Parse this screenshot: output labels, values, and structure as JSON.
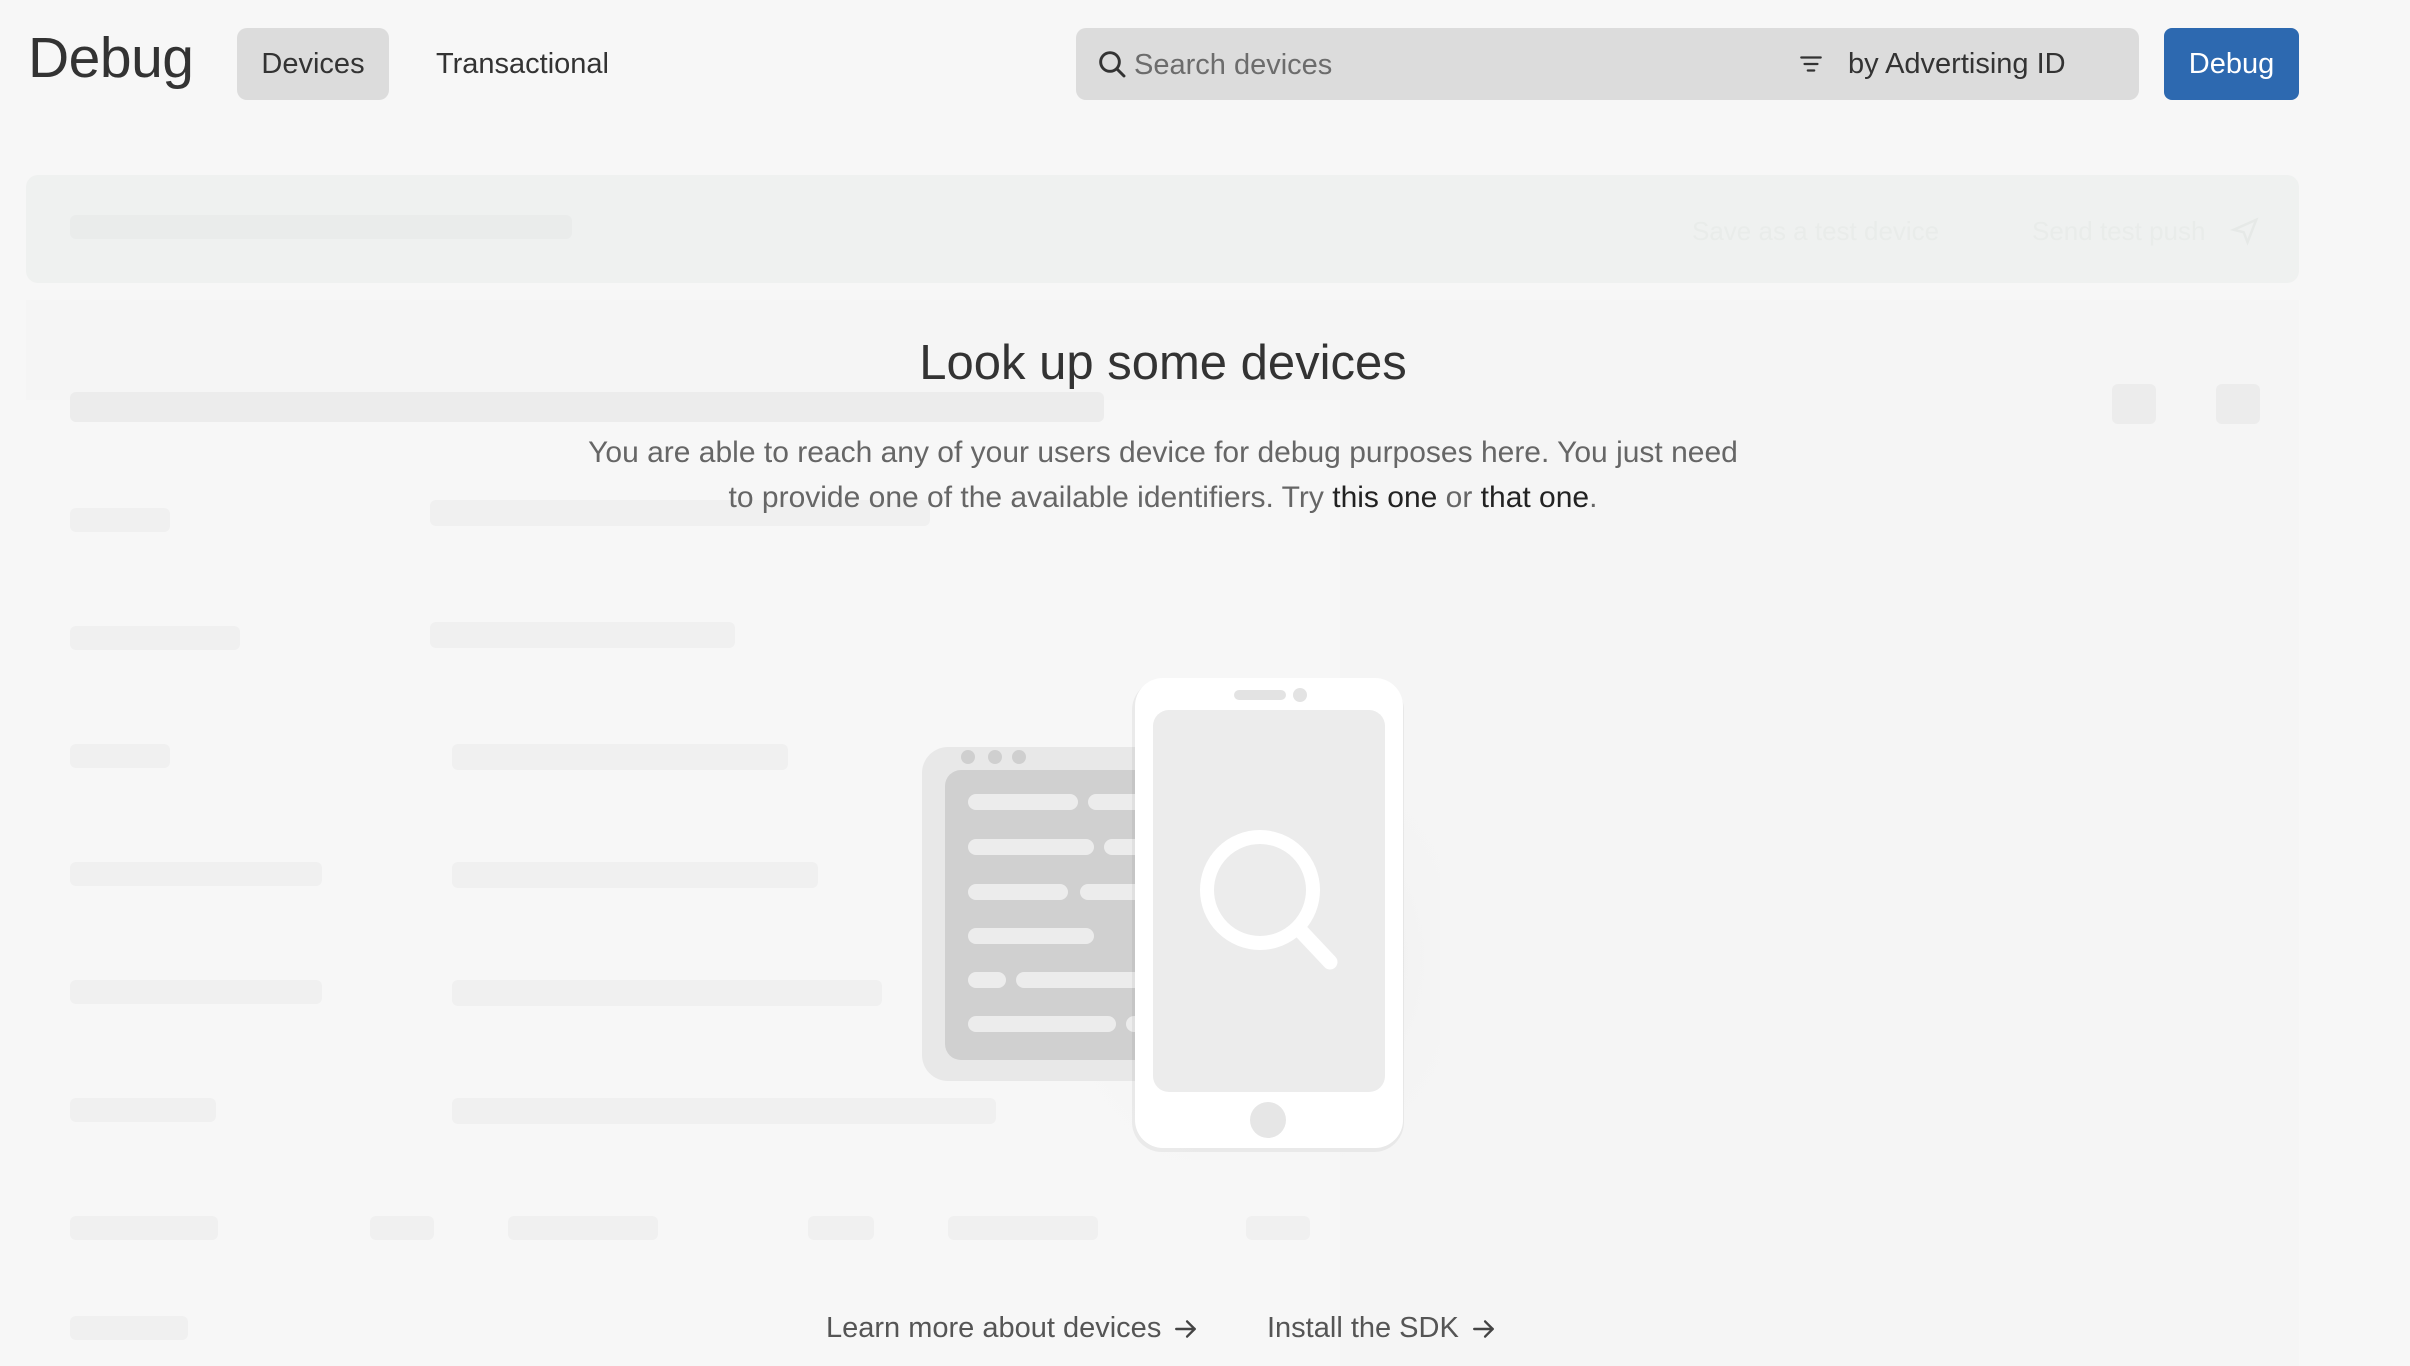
{
  "header": {
    "title": "Debug",
    "tabs": [
      {
        "label": "Devices",
        "active": true
      },
      {
        "label": "Transactional",
        "active": false
      }
    ],
    "search": {
      "placeholder": "Search devices",
      "value": ""
    },
    "filter_label": "by Advertising ID",
    "debug_button": "Debug"
  },
  "background_toolbar": {
    "save_test_device": "Save as a test device",
    "send_test_push": "Send test push"
  },
  "empty_state": {
    "title": "Look up some devices",
    "desc_line1": "You are able to reach any of your users device for debug purposes here. You just need",
    "desc_line2_pre": "to provide one of the available identifiers. Try ",
    "link_this_one": "this one",
    "desc_or": " or ",
    "link_that_one": "that one",
    "desc_end": "."
  },
  "footer": {
    "learn_more": "Learn more about devices",
    "install_sdk": "Install the SDK"
  },
  "colors": {
    "accent": "#2d69b0",
    "background": "#f7f7f7",
    "tab_active_bg": "#dcdcdc"
  },
  "icons": [
    "search-icon",
    "filter-icon",
    "send-icon",
    "arrow-right-icon",
    "phone-search-illustration"
  ]
}
